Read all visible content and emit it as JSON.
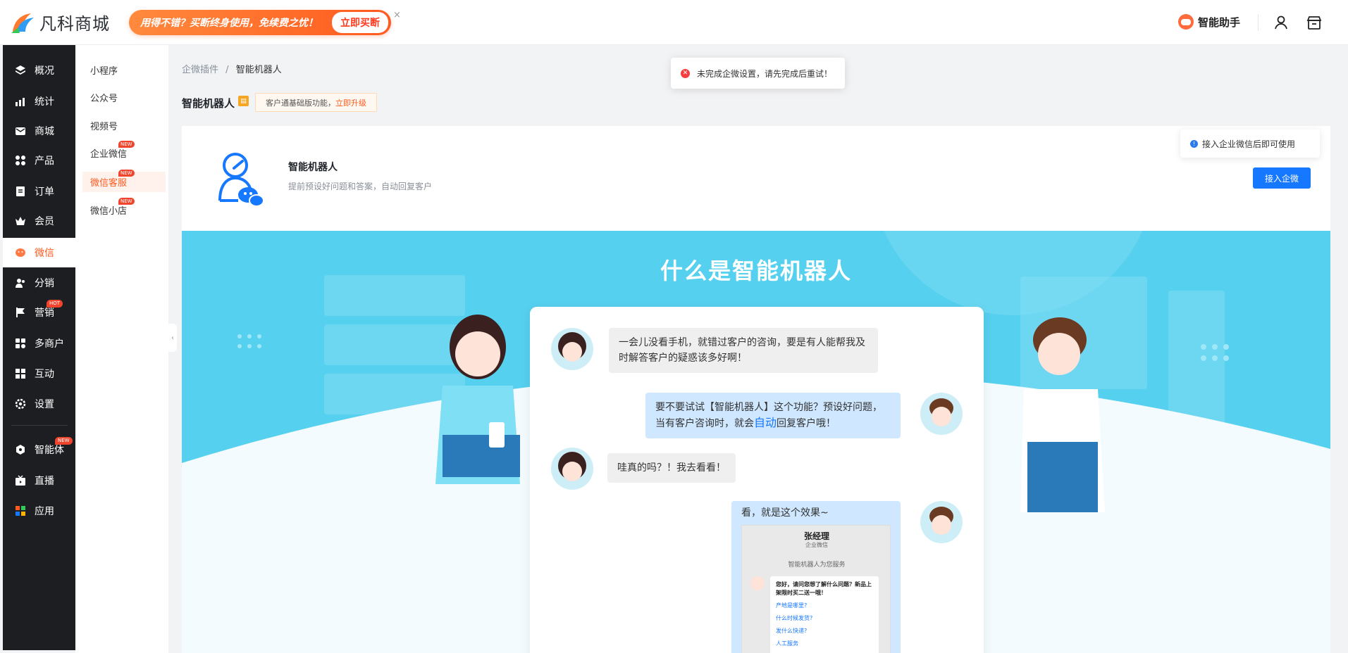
{
  "brand": {
    "name": "凡科商城"
  },
  "promo": {
    "text": "用得不错？买断终身使用，免续费之忧！",
    "button": "立即买断",
    "close": "×"
  },
  "header": {
    "assistant_label": "智能助手",
    "user_icon": "user-icon",
    "store_icon": "store-icon"
  },
  "sidebar": {
    "items": [
      {
        "label": "概况",
        "icon": "layers-icon"
      },
      {
        "label": "统计",
        "icon": "chart-icon"
      },
      {
        "label": "商城",
        "icon": "mail-icon"
      },
      {
        "label": "产品",
        "icon": "grid-icon"
      },
      {
        "label": "订单",
        "icon": "order-icon"
      },
      {
        "label": "会员",
        "icon": "crown-icon"
      },
      {
        "label": "微信",
        "icon": "wechat-icon"
      },
      {
        "label": "分销",
        "icon": "users-icon"
      },
      {
        "label": "营销",
        "icon": "flag-icon",
        "badge": "HOT"
      },
      {
        "label": "多商户",
        "icon": "merchant-icon"
      },
      {
        "label": "互动",
        "icon": "interaction-icon"
      },
      {
        "label": "设置",
        "icon": "gear-icon"
      },
      {
        "label": "智能体",
        "icon": "cube-icon",
        "badge": "NEW"
      },
      {
        "label": "直播",
        "icon": "tv-icon"
      },
      {
        "label": "应用",
        "icon": "apps-icon"
      }
    ]
  },
  "submenu": {
    "items": [
      {
        "label": "小程序"
      },
      {
        "label": "公众号"
      },
      {
        "label": "视频号"
      },
      {
        "label": "企业微信",
        "badge": "NEW"
      },
      {
        "label": "微信客服",
        "badge": "NEW"
      },
      {
        "label": "微信小店",
        "badge": "NEW"
      }
    ],
    "collapse": "‹"
  },
  "breadcrumb": {
    "parent": "企微插件",
    "sep": "/",
    "current": "智能机器人"
  },
  "page": {
    "title": "智能机器人",
    "upgrade_text": "客户通基础版功能，",
    "upgrade_link": "立即升级"
  },
  "toast": {
    "text": "未完成企微设置，请先完成后重试！"
  },
  "plugin": {
    "name": "智能机器人",
    "desc": "提前预设好问题和答案，自动回复客户",
    "tip": "接入企业微信后即可使用",
    "connect_button": "接入企微"
  },
  "banner": {
    "title": "什么是智能机器人",
    "messages": [
      {
        "text": "一会儿没看手机，就错过客户的咨询，要是有人能帮我及时解答客户的疑惑该多好啊！"
      },
      {
        "text_before": "要不要试试【智能机器人】这个功能？预设好问题，当有客户咨询时，就会",
        "highlight": "自动",
        "text_after": "回复客户哦！"
      },
      {
        "text": "哇真的吗？！我去看看！"
      },
      {
        "text": "看，就是这个效果~"
      }
    ],
    "phone": {
      "name": "张经理",
      "sub": "企业微信",
      "serving": "智能机器人为您服务",
      "greeting": "您好，请问您想了解什么问题？新品上架限时买二送一哦！",
      "links": [
        "产地是哪里?",
        "什么时候发货?",
        "发什么快递?",
        "人工服务"
      ]
    }
  },
  "colors": {
    "accent": "#ff5a1f",
    "primary": "#1677ff",
    "banner": "#55d0ee",
    "sidebar": "#1d1e22"
  }
}
